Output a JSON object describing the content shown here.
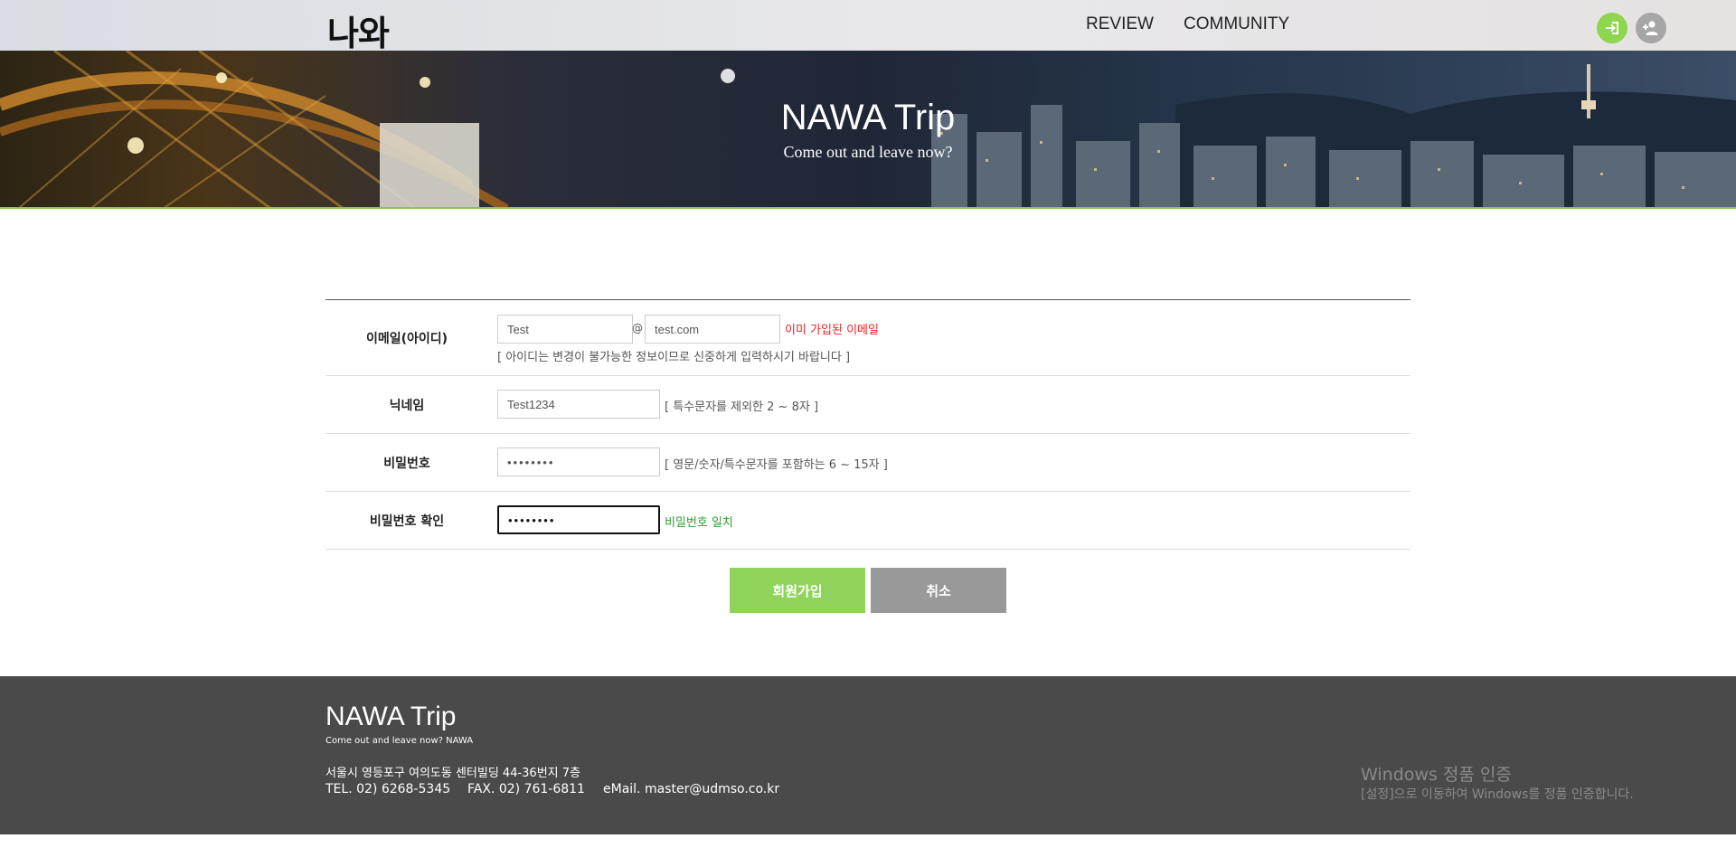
{
  "header": {
    "logo": "나와",
    "nav": [
      {
        "label": "REVIEW"
      },
      {
        "label": "COMMUNITY"
      }
    ],
    "icons": {
      "login": "login-icon",
      "join": "add-user-icon"
    },
    "colors": {
      "login_button": "#8fd64f",
      "join_button": "#a6a6a6"
    }
  },
  "hero": {
    "title": "NAWA Trip",
    "subtitle": "Come out and leave now?"
  },
  "form": {
    "email": {
      "label": "이메일(아이디)",
      "local_value": "Test",
      "at": "@",
      "domain_value": "test.com",
      "error": "이미 가입된 이메일",
      "hint": "[ 아이디는 변경이 불가능한 정보이므로 신중하게 입력하시기 바랍니다 ]"
    },
    "nickname": {
      "label": "닉네임",
      "value": "Test1234",
      "hint": "[ 특수문자를 제외한 2 ~ 8자 ]"
    },
    "password": {
      "label": "비밀번호",
      "value": "••••••••",
      "hint": "[ 영문/숫자/특수문자를 포함하는 6 ~ 15자 ]"
    },
    "password_confirm": {
      "label": "비밀번호 확인",
      "value": "••••••••",
      "status": "비밀번호 일치"
    },
    "submit_label": "회원가입",
    "cancel_label": "취소",
    "colors": {
      "submit": "#8fd35a",
      "cancel": "#999999",
      "error": "#ee2222",
      "ok": "#2e9d2e"
    }
  },
  "footer": {
    "title": "NAWA Trip",
    "subtitle": "Come out and leave now? NAWA",
    "address": "서울시 영등포구 여의도동 센터빌딩 44-36번지 7층",
    "tel": "TEL. 02) 6268-5345",
    "fax": "FAX. 02) 761-6811",
    "email": "eMail. master@udmso.co.kr"
  },
  "watermark": {
    "line1": "Windows 정품 인증",
    "line2": "[설정]으로 이동하여 Windows를 정품 인증합니다."
  }
}
